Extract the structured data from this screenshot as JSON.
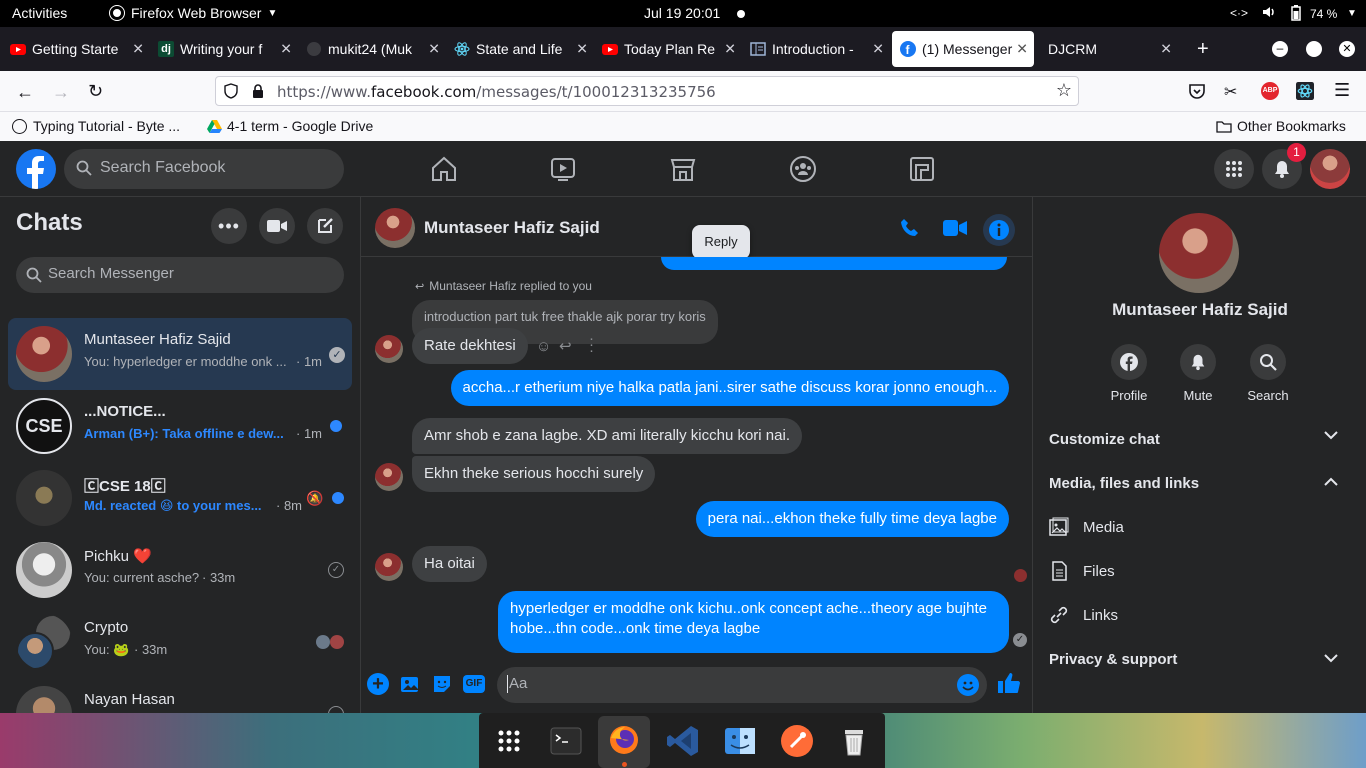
{
  "os": {
    "activities": "Activities",
    "app_menu": "Firefox Web Browser",
    "clock": "Jul 19  20:01",
    "battery": "74 %"
  },
  "tabs": [
    {
      "label": "Getting Starte",
      "icon": "youtube-icon"
    },
    {
      "label": "Writing your f",
      "icon": "django-icon"
    },
    {
      "label": "mukit24 (Muk",
      "icon": "github-icon"
    },
    {
      "label": "State and Life",
      "icon": "react-icon"
    },
    {
      "label": "Today Plan Re",
      "icon": "youtube-icon"
    },
    {
      "label": "Introduction -",
      "icon": "doc-icon"
    },
    {
      "label": "(1) Messenger",
      "icon": "facebook-icon"
    },
    {
      "label": "DJCRM",
      "icon": "none"
    }
  ],
  "url": {
    "prefix": "https://www.",
    "domain": "facebook.com",
    "path": "/messages/t/100012313235756"
  },
  "bookmarks": {
    "b1": "Typing Tutorial - Byte ...",
    "b2": "4-1 term - Google Drive",
    "other": "Other Bookmarks"
  },
  "fb": {
    "search_placeholder": "Search Facebook",
    "notif_count": "1"
  },
  "chats": {
    "title": "Chats",
    "search_placeholder": "Search Messenger",
    "items": [
      {
        "name": "Muntaseer Hafiz Sajid",
        "preview": "You: hyperledger er moddhe onk ...",
        "time": "· 1m"
      },
      {
        "name": "...NOTICE...",
        "preview": "Arman (B+): Taka offline e dew...",
        "time": "· 1m"
      },
      {
        "name": "🄲CSE 18🄲",
        "preview": "Md. reacted 😆 to your mes...",
        "time": "· 8m"
      },
      {
        "name": "Pichku ❤️",
        "preview": "You: current asche?",
        "time": "· 33m"
      },
      {
        "name": "Crypto",
        "preview": "You: 🐸",
        "time": "· 33m"
      },
      {
        "name": "Nayan Hasan",
        "preview": "",
        "time": ""
      }
    ]
  },
  "conversation": {
    "contact": "Muntaseer Hafiz Sajid",
    "reply_tooltip": "Reply",
    "replied_label": "Muntaseer Hafiz replied to you",
    "quoted": "introduction part tuk free thakle ajk porar try koris",
    "messages": [
      {
        "dir": "in",
        "text": "Rate dekhtesi"
      },
      {
        "dir": "out",
        "text": "accha...r etherium niye halka patla jani..sirer sathe discuss korar jonno enough..."
      },
      {
        "dir": "in",
        "text": "Amr shob e zana lagbe. XD ami literally kicchu kori nai."
      },
      {
        "dir": "in",
        "text": "Ekhn theke serious hocchi surely"
      },
      {
        "dir": "out",
        "text": "pera nai...ekhon theke fully time deya lagbe"
      },
      {
        "dir": "in",
        "text": "Ha oitai"
      },
      {
        "dir": "out",
        "text": "hyperledger er moddhe onk kichu..onk concept ache...theory age bujhte\nhobe...thn code...onk time deya lagbe"
      }
    ],
    "composer_placeholder": "Aa"
  },
  "info": {
    "name": "Muntaseer Hafiz Sajid",
    "actions": {
      "profile": "Profile",
      "mute": "Mute",
      "search": "Search"
    },
    "customize": "Customize chat",
    "media_files": "Media, files and links",
    "media": "Media",
    "files": "Files",
    "links": "Links",
    "privacy": "Privacy & support"
  },
  "colors": {
    "fb_blue": "#0084ff",
    "bg": "#242526",
    "bubble_in": "#3e4042"
  }
}
